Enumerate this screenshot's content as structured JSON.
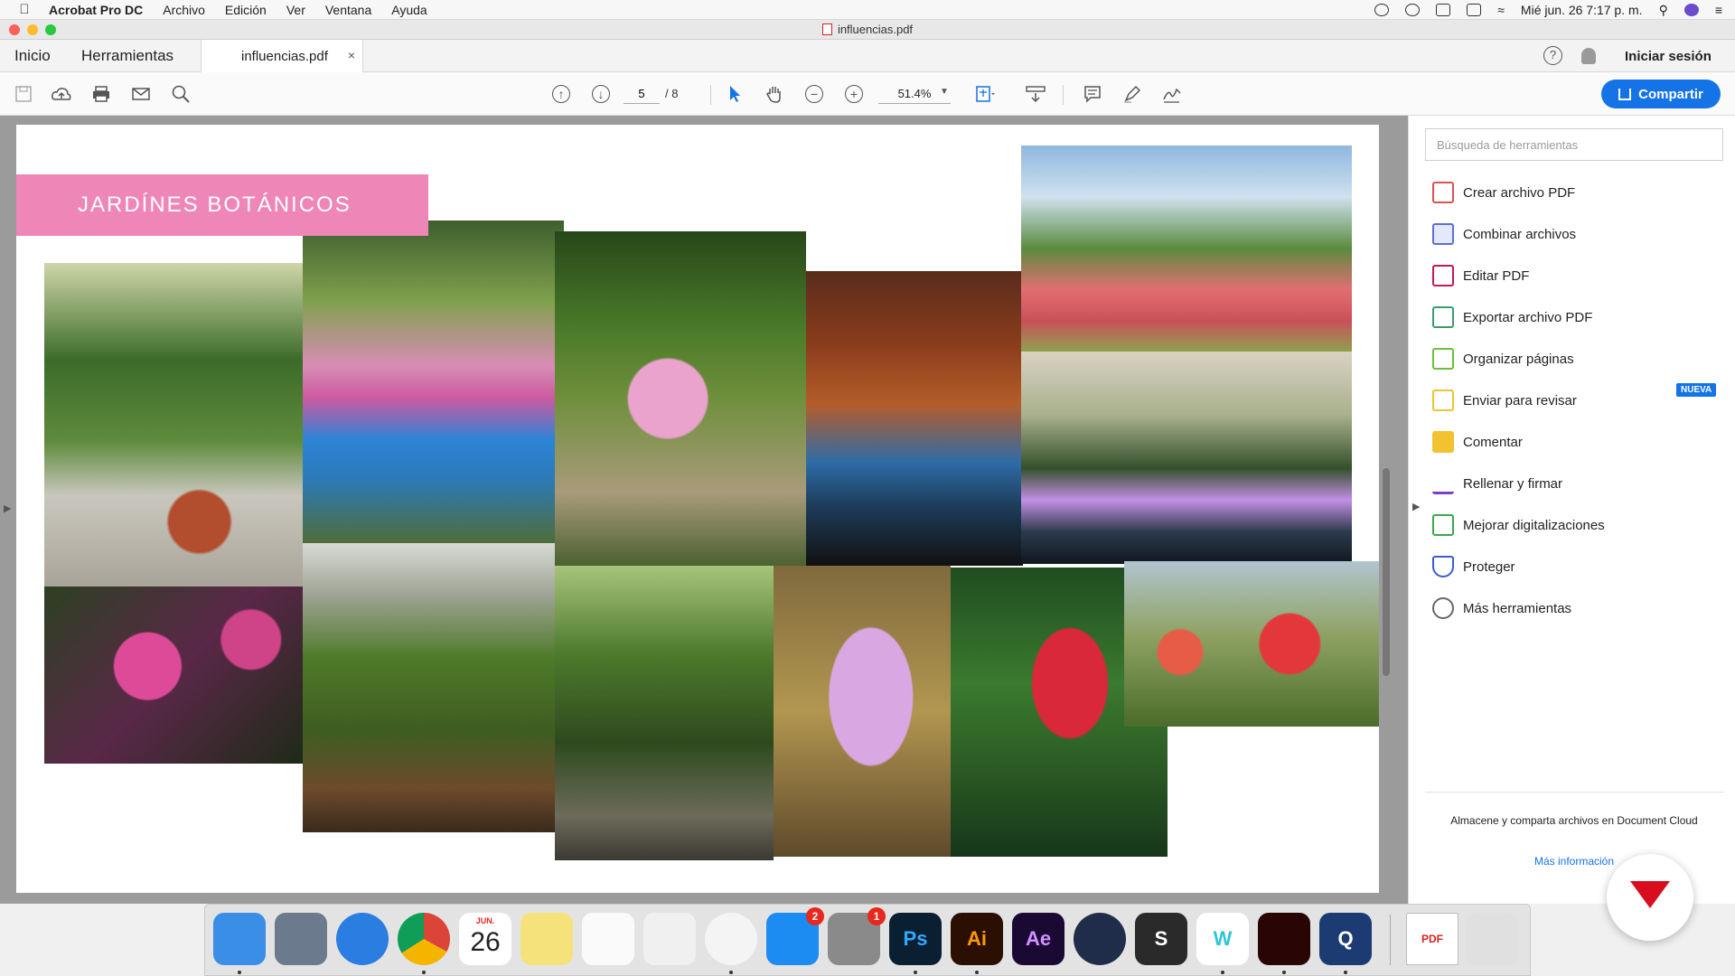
{
  "menubar": {
    "app_name": "Acrobat Pro DC",
    "menus": [
      "Archivo",
      "Edición",
      "Ver",
      "Ventana",
      "Ayuda"
    ],
    "clock": "Mié jun. 26  7:17 p. m."
  },
  "window": {
    "title": "influencias.pdf"
  },
  "tabs": {
    "home": "Inicio",
    "tools": "Herramientas",
    "document": "influencias.pdf",
    "close": "×",
    "help": "?",
    "sign_in": "Iniciar sesión"
  },
  "toolbar": {
    "page_current": "5",
    "page_total": "/ 8",
    "zoom": "51.4%",
    "share_label": "Compartir"
  },
  "document": {
    "banner_title": "JARDÍNES BOTÁNICOS",
    "photos": [
      "conservatory-woman",
      "greenhouse-flowers",
      "orchid-path",
      "orange-canopy-structure",
      "garden-pergola-flowers",
      "park-fountain-night",
      "pink-roses",
      "dome-greenhouse",
      "forest-walkway",
      "purple-crocus",
      "red-heliconia",
      "red-roses"
    ]
  },
  "tools_pane": {
    "search_placeholder": "Búsqueda de herramientas",
    "tools": [
      {
        "label": "Crear archivo PDF",
        "color": "#d9534f"
      },
      {
        "label": "Combinar archivos",
        "color": "#5b6fd6"
      },
      {
        "label": "Editar PDF",
        "color": "#c2185b"
      },
      {
        "label": "Exportar archivo PDF",
        "color": "#3a9d6e"
      },
      {
        "label": "Organizar páginas",
        "color": "#6bbf3a"
      },
      {
        "label": "Enviar para revisar",
        "color": "#f2c230"
      },
      {
        "label": "Comentar",
        "color": "#f2c230"
      },
      {
        "label": "Rellenar y firmar",
        "color": "#7b3fc4"
      },
      {
        "label": "Mejorar digitalizaciones",
        "color": "#3aa84a"
      },
      {
        "label": "Proteger",
        "color": "#3b5bd6"
      },
      {
        "label": "Más herramientas",
        "color": "#666666"
      }
    ],
    "new_badge": "NUEVA",
    "cloud_text": "Almacene y comparta archivos en Document Cloud",
    "more_info": "Más información"
  },
  "dock": {
    "calendar_month": "JUN.",
    "calendar_day": "26",
    "appstore_badge": "2",
    "prefs_badge": "1",
    "apps": [
      {
        "name": "finder",
        "label": "",
        "bg": "#3a8ee6"
      },
      {
        "name": "launchpad",
        "label": "",
        "bg": "#6b7a8c"
      },
      {
        "name": "safari",
        "label": "",
        "bg": "#2a7de1"
      },
      {
        "name": "chrome",
        "label": "",
        "bg": "#e8e8e8"
      },
      {
        "name": "calendar",
        "label": "",
        "bg": "#ffffff"
      },
      {
        "name": "notes",
        "label": "",
        "bg": "#f6e27a"
      },
      {
        "name": "reminders",
        "label": "",
        "bg": "#fafafa"
      },
      {
        "name": "photos",
        "label": "",
        "bg": "#f0f0f0"
      },
      {
        "name": "itunes",
        "label": "",
        "bg": "#f4f4f4"
      },
      {
        "name": "app-store",
        "label": "",
        "bg": "#1c8cf2"
      },
      {
        "name": "system-preferences",
        "label": "",
        "bg": "#8a8a8a"
      },
      {
        "name": "photoshop",
        "label": "Ps",
        "bg": "#0b1f33"
      },
      {
        "name": "illustrator",
        "label": "Ai",
        "bg": "#2b0f03"
      },
      {
        "name": "after-effects",
        "label": "Ae",
        "bg": "#1a0933"
      },
      {
        "name": "cinema-4d",
        "label": "",
        "bg": "#1f2d4a"
      },
      {
        "name": "sketchup-s",
        "label": "S",
        "bg": "#2a2a2a"
      },
      {
        "name": "word-w",
        "label": "W",
        "bg": "#ffffff"
      },
      {
        "name": "acrobat",
        "label": "",
        "bg": "#2a0505"
      },
      {
        "name": "quicktime",
        "label": "Q",
        "bg": "#1d3b73"
      },
      {
        "name": "pdf-document",
        "label": "PDF",
        "bg": "#ffffff"
      },
      {
        "name": "trash",
        "label": "",
        "bg": "#e0e0e0"
      }
    ]
  }
}
